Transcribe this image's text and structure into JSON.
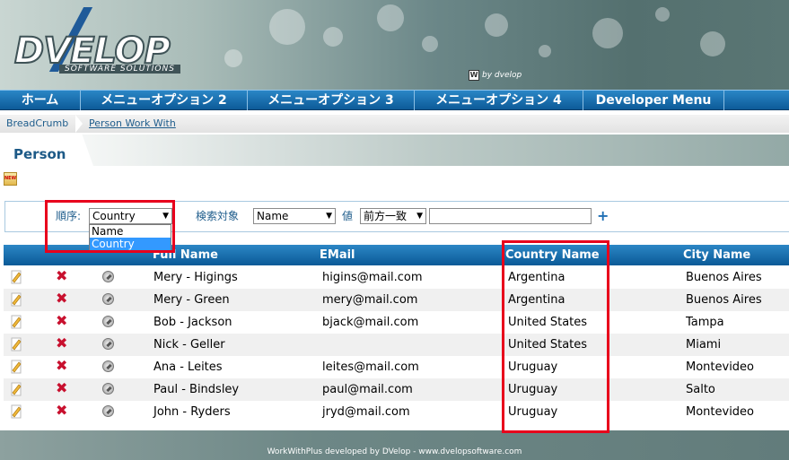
{
  "header": {
    "logo_text": "DVELOP",
    "logo_sub": "SOFTWARE SOLUTIONS",
    "powered_badge": "W",
    "powered_text": "by dvelop"
  },
  "menu": {
    "items": [
      "ホーム",
      "メニューオプション 2",
      "メニューオプション 3",
      "メニューオプション 4",
      "Developer Menu"
    ]
  },
  "breadcrumb": {
    "home": "BreadCrumb",
    "current": "Person Work With"
  },
  "page": {
    "title": "Person",
    "new_icon_label": "NEW"
  },
  "filter": {
    "order_label": "順序:",
    "order_value": "Country",
    "order_options": [
      "Name",
      "Country"
    ],
    "order_selected": "Country",
    "search_target_label": "検索対象",
    "search_target_value": "Name",
    "value_label": "値",
    "match_value": "前方一致",
    "search_text": "",
    "add_button": "+"
  },
  "grid": {
    "columns": [
      "Full Name",
      "EMail",
      "Country Name",
      "City Name"
    ],
    "rows": [
      {
        "name": "Mery - Higings",
        "email": "higins@mail.com",
        "country": "Argentina",
        "city": "Buenos Aires"
      },
      {
        "name": "Mery - Green",
        "email": "mery@mail.com",
        "country": "Argentina",
        "city": "Buenos Aires"
      },
      {
        "name": "Bob - Jackson",
        "email": "bjack@mail.com",
        "country": "United States",
        "city": "Tampa"
      },
      {
        "name": "Nick - Geller",
        "email": "",
        "country": "United States",
        "city": "Miami"
      },
      {
        "name": "Ana - Leites",
        "email": "leites@mail.com",
        "country": "Uruguay",
        "city": "Montevideo"
      },
      {
        "name": "Paul - Bindsley",
        "email": "paul@mail.com",
        "country": "Uruguay",
        "city": "Salto"
      },
      {
        "name": "John - Ryders",
        "email": "jryd@mail.com",
        "country": "Uruguay",
        "city": "Montevideo"
      }
    ],
    "delete_glyph": "✖"
  },
  "footer": {
    "text": "WorkWithPlus developed by DVelop - www.dvelopsoftware.com"
  },
  "colors": {
    "menu_blue": "#0d5b98",
    "link_blue": "#1f5d8c",
    "highlight_red": "#e8001c",
    "option_selected": "#3399ff"
  }
}
